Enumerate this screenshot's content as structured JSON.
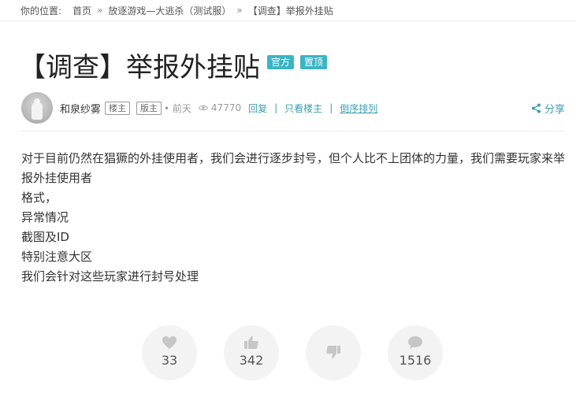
{
  "breadcrumb": {
    "prefix": "你的位置:",
    "items": [
      {
        "label": "首页"
      },
      {
        "label": "放逐游戏—大逃杀（测试服）"
      },
      {
        "label": "【调查】举报外挂贴"
      }
    ],
    "separator": "»"
  },
  "post": {
    "title": "【调查】举报外挂贴",
    "tags": [
      "官方",
      "置顶"
    ],
    "author": "和泉纱雾",
    "author_badges": [
      "楼主",
      "版主"
    ],
    "time": "• 前天",
    "views": "47770",
    "links": {
      "reply": "回复",
      "only_op": "只看楼主",
      "reverse": "倒序排列"
    },
    "share": "分享",
    "content": [
      "对于目前仍然在猖獗的外挂使用者，我们会进行逐步封号，但个人比不上团体的力量，我们需要玩家来举报外挂使用者",
      "格式，",
      "异常情况",
      "截图及ID",
      "特别注意大区",
      "我们会针对这些玩家进行封号处理"
    ]
  },
  "actions": {
    "favorite": {
      "icon": "heart-icon",
      "count": "33"
    },
    "like": {
      "icon": "thumbs-up-icon",
      "count": "342"
    },
    "dislike": {
      "icon": "thumbs-down-icon",
      "count": ""
    },
    "comment": {
      "icon": "comment-icon",
      "count": "1516"
    }
  },
  "colors": {
    "accent": "#3b9fb0",
    "tag_bg": "#3bb4c6",
    "action_bg": "#f3f3f3",
    "action_icon": "#c6c6c6"
  }
}
